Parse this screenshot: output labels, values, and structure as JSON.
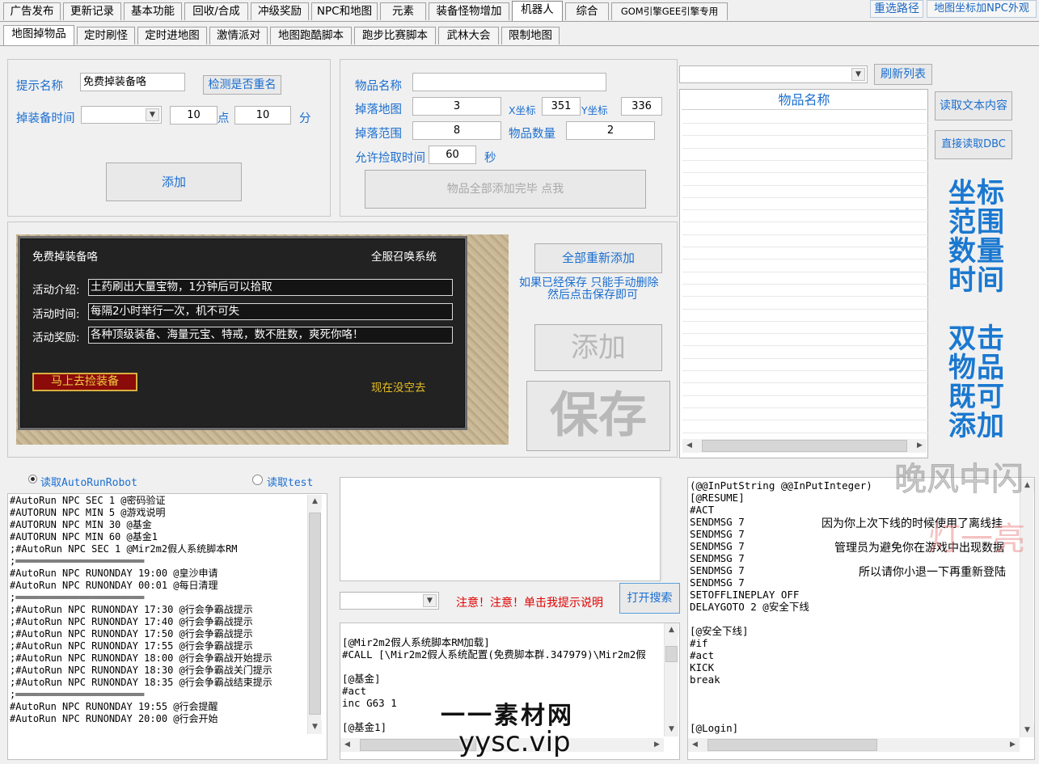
{
  "top_tabs": [
    "广告发布",
    "更新记录",
    "基本功能",
    "回收/合成",
    "冲级奖励",
    "NPC和地图",
    "元素",
    "装备怪物增加",
    "机器人",
    "综合",
    "GOM引擎GEE引擎专用"
  ],
  "top_right": {
    "reselect_path": "重选路径",
    "map_coord_npc": "地图坐标加NPC外观"
  },
  "sub_tabs": [
    "地图掉物品",
    "定时刷怪",
    "定时进地图",
    "激情派对",
    "地图跑酷脚本",
    "跑步比赛脚本",
    "武林大会",
    "限制地图"
  ],
  "left_form": {
    "prompt_name_label": "提示名称",
    "prompt_name_value": "免费掉装备咯",
    "check_dup_button": "检测是否重名",
    "drop_time_label": "掉装备时间",
    "hour_value": "10",
    "hour_unit": "点",
    "minute_value": "10",
    "minute_unit": "分",
    "add_button": "添加"
  },
  "item_form": {
    "item_name_label": "物品名称",
    "item_name_value": "",
    "drop_map_label": "掉落地图",
    "drop_map_value": "3",
    "x_label": "X坐标",
    "x_value": "351",
    "y_label": "Y坐标",
    "y_value": "336",
    "range_label": "掉落范围",
    "range_value": "8",
    "qty_label": "物品数量",
    "qty_value": "2",
    "pickup_label": "允许捡取时间",
    "pickup_value": "60",
    "pickup_unit": "秒",
    "done_button": "物品全部添加完毕 点我"
  },
  "preview": {
    "title": "免费掉装备咯",
    "system": "全服召唤系统",
    "intro_label": "活动介绍:",
    "intro_value": "土药刷出大量宝物，1分钟后可以拾取",
    "time_label": "活动时间:",
    "time_value": "每隔2小时举行一次，机不可失",
    "reward_label": "活动奖励:",
    "reward_value": "各种顶级装备、海量元宝、特戒，数不胜数，爽死你咯！",
    "go_button": "马上去捡装备",
    "no_time": "现在没空去"
  },
  "mid_actions": {
    "readd_all": "全部重新添加",
    "note_line1": "如果已经保存 只能手动删除",
    "note_line2": "然后点击保存即可",
    "add_big": "添加",
    "save_big": "保存"
  },
  "list_panel": {
    "refresh_button": "刷新列表",
    "column_header": "物品名称",
    "read_text_button": "读取文本内容",
    "read_dbc_button": "直接读取DBC"
  },
  "hint_block": {
    "line1": "坐标",
    "line2": "范围",
    "line3": "数量",
    "line4": "时间",
    "line5": "双击",
    "line6": "物品",
    "line7": "既可",
    "line8": "添加"
  },
  "radios": {
    "option1": "读取AutoRunRobot",
    "option2": "读取test"
  },
  "autorun_lines": [
    "#AutoRun NPC SEC 1 @密码验证",
    "#AUTORUN NPC MIN 5 @游戏说明",
    "#AUTORUN NPC MIN 30 @基金",
    "#AUTORUN NPC MIN 60 @基金1",
    ";#AutoRun NPC SEC 1 @Mir2m2假人系统脚本RM",
    ";══════════════════════",
    "#AutoRun NPC RUNONDAY 19:00 @皇沙申请",
    "#AutoRun NPC RUNONDAY 00:01 @每日清理",
    ";══════════════════════",
    ";#AutoRun NPC RUNONDAY 17:30 @行会争霸战提示",
    ";#AutoRun NPC RUNONDAY 17:40 @行会争霸战提示",
    ";#AutoRun NPC RUNONDAY 17:50 @行会争霸战提示",
    ";#AutoRun NPC RUNONDAY 17:55 @行会争霸战提示",
    ";#AutoRun NPC RUNONDAY 18:00 @行会争霸战开始提示",
    ";#AutoRun NPC RUNONDAY 18:30 @行会争霸战关门提示",
    ";#AutoRun NPC RUNONDAY 18:35 @行会争霸战结束提示",
    ";══════════════════════",
    "#AutoRun NPC RUNONDAY 19:55 @行会提醒",
    "#AutoRun NPC RUNONDAY 20:00 @行会开始"
  ],
  "search_row": {
    "warning": "注意！注意！单击我提示说明",
    "open_search": "打开搜索"
  },
  "mid_code_lines": [
    "[@Mir2m2假人系统脚本RM加载]",
    "#CALL [\\Mir2m2假人系统配置(免费脚本群.347979)\\Mir2m2假",
    "",
    "[@基金]",
    "#act",
    "inc G63 1",
    "",
    "[@基金1]"
  ],
  "right_code_lines": [
    "(@@InPutString @@InPutInteger)",
    "[@RESUME]",
    "#ACT",
    "SENDMSG 7",
    "SENDMSG 7",
    "SENDMSG 7",
    "SENDMSG 7",
    "SENDMSG 7",
    "SENDMSG 7",
    "SETOFFLINEPLAY OFF",
    "DELAYGOTO 2 @安全下线",
    "",
    "[@安全下线]",
    "#if",
    "#act",
    "KICK",
    "break",
    "",
    "",
    "",
    "[@Login]"
  ],
  "right_messages": {
    "m1": "因为你上次下线的时候使用了离线挂",
    "m2": "管理员为避免你在游戏中出现数据",
    "m3": "所以请你小退一下再重新登陆"
  },
  "watermarks": {
    "corner_a": "晚风中闪",
    "corner_b": "灯一亮",
    "footer_brand": "一一素材网",
    "footer_url": "yysc.vip"
  },
  "colors": {
    "accent": "#1a6ed0",
    "warning": "#e00000",
    "hint": "#1a78d0",
    "gold": "#e8c020"
  }
}
